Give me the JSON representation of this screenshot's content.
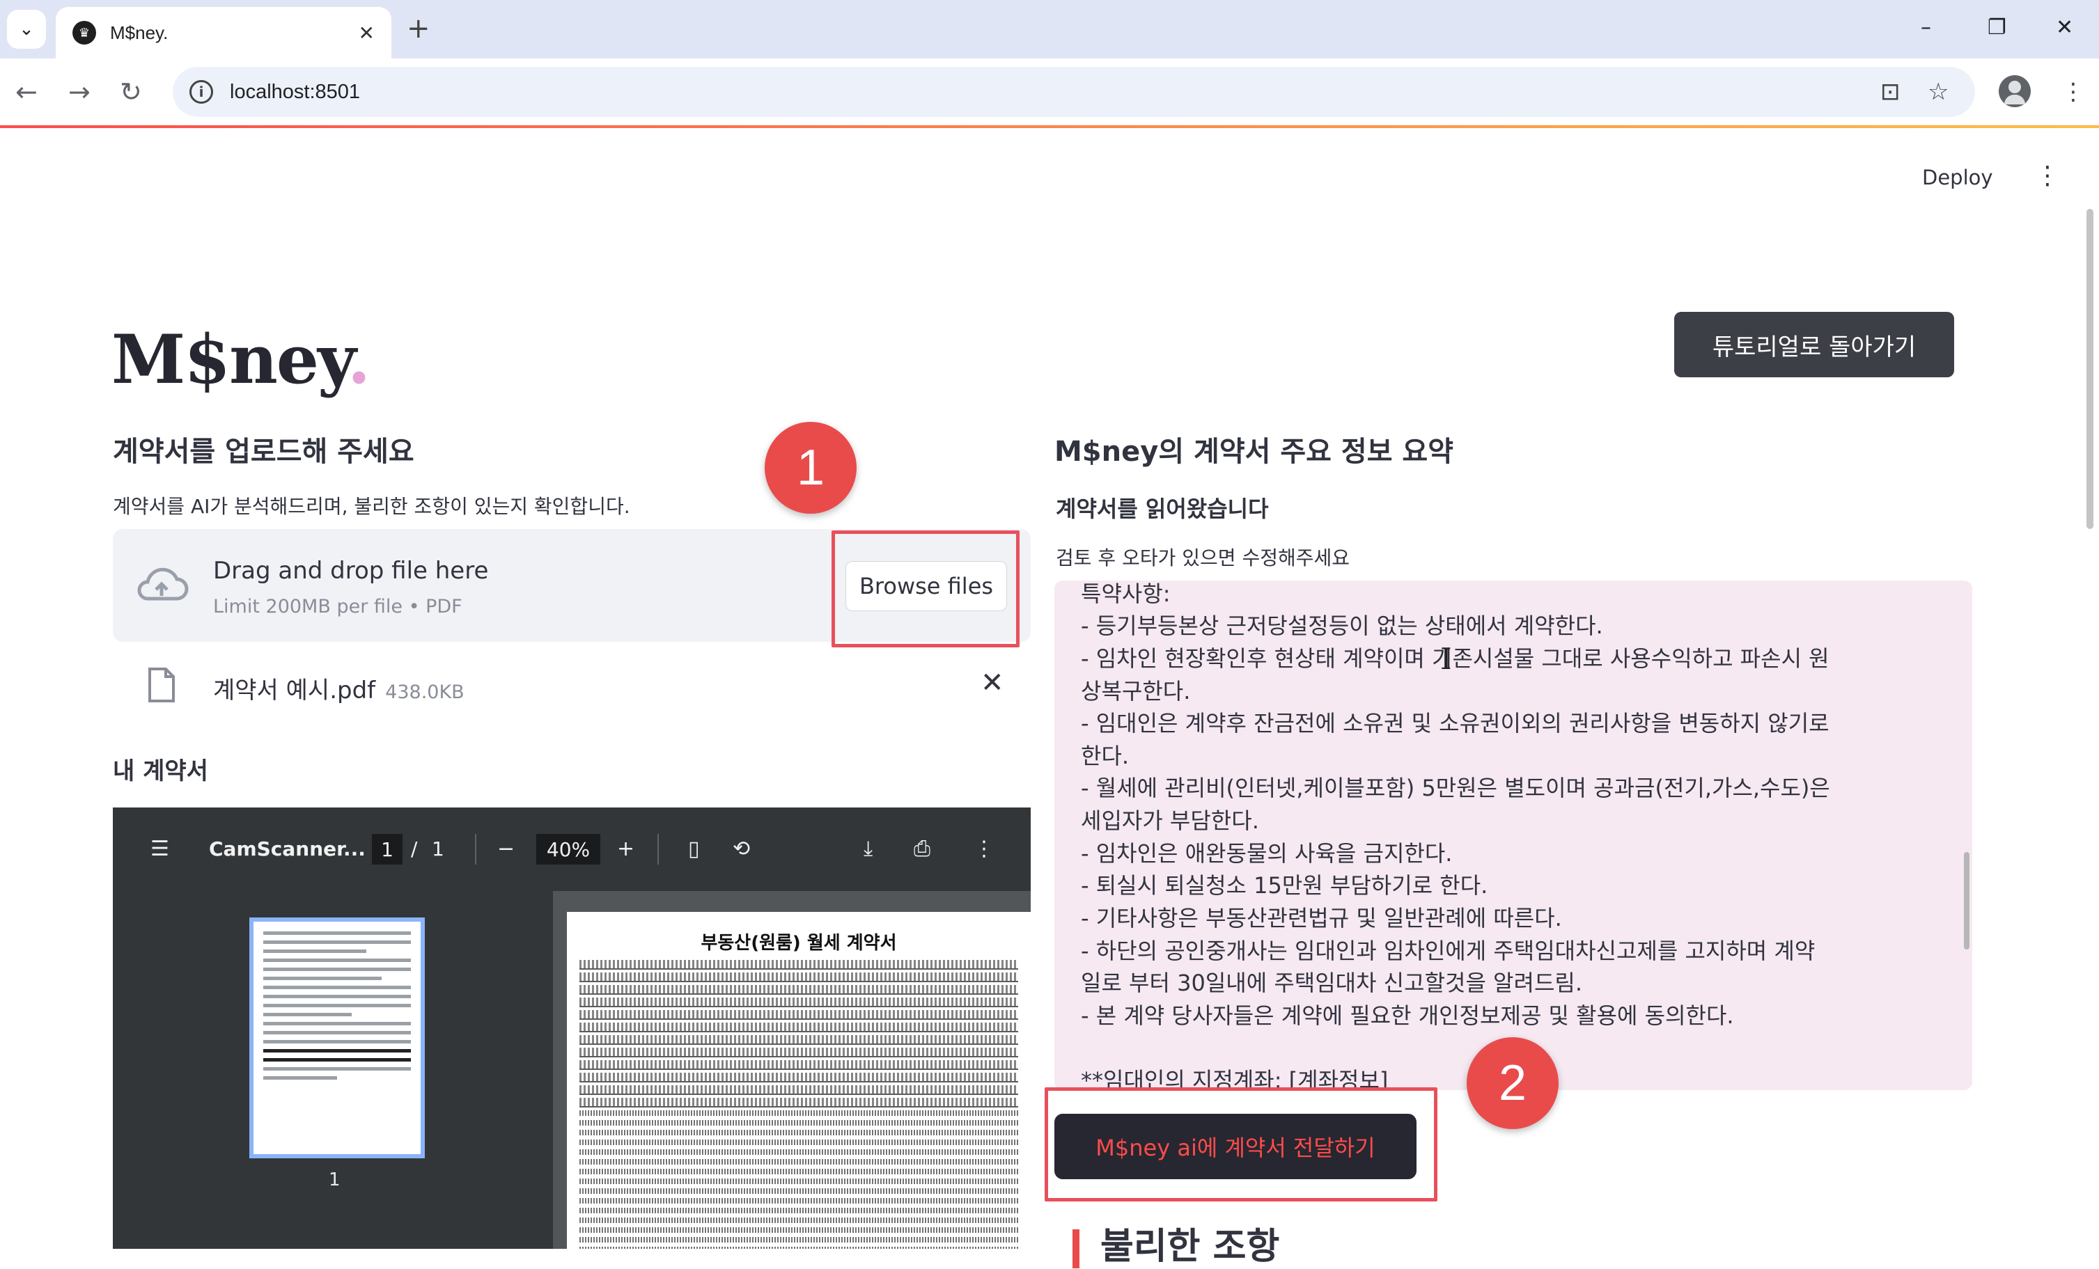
{
  "browser": {
    "tab_title": "M$ney.",
    "tab_favicon": "♛",
    "new_tab": "+",
    "url": "localhost:8501",
    "window_controls": [
      "–",
      "❐",
      "✕"
    ]
  },
  "app": {
    "deploy": "Deploy",
    "menu": "⋮",
    "logo_text": "M$ney",
    "logo_dot": ".",
    "tutorial_button": "튜토리얼로 돌아가기"
  },
  "upload": {
    "heading": "계약서를 업로드해 주세요",
    "caption": "계약서를 AI가 분석해드리며, 불리한 조항이 있는지 확인합니다.",
    "drag_text": "Drag and drop file here",
    "limit_text": "Limit 200MB per file • PDF",
    "browse_label": "Browse files",
    "file_name": "계약서 예시.pdf",
    "file_size": "438.0KB",
    "remove": "✕"
  },
  "annotations": {
    "badge1": "1",
    "badge2": "2"
  },
  "pdf": {
    "section_heading": "내 계약서",
    "doc_title": "CamScanner...",
    "page_current": "1",
    "page_sep": "/",
    "page_total": "1",
    "zoom_minus": "−",
    "zoom": "40%",
    "zoom_plus": "+",
    "thumb_page": "1",
    "page_title": "부동산(원룸) 월세 계약서"
  },
  "summary": {
    "heading": "M$ney의 계약서 주요 정보 요약",
    "subheading": "계약서를 읽어왔습니다",
    "caption": "검토 후 오타가 있으면 수정해주세요",
    "lines": [
      "특약사항:",
      "- 등기부등본상 근저당설정등이 없는 상태에서 계약한다.",
      "- 임차인 현장확인후 현상태 계약이며 기존시설물 그대로 사용수익하고 파손시 원",
      "상복구한다.",
      "- 임대인은 계약후 잔금전에 소유권 및 소유권이외의 권리사항을 변동하지 않기로",
      "한다.",
      "- 월세에 관리비(인터넷,케이블포함) 5만원은 별도이며 공과금(전기,가스,수도)은",
      "세입자가 부담한다.",
      "- 임차인은 애완동물의 사육을 금지한다.",
      "- 퇴실시 퇴실청소 15만원 부담하기로 한다.",
      "- 기타사항은 부동산관련법규 및 일반관례에 따른다.",
      "- 하단의 공인중개사는 임대인과 임차인에게 주택임대차신고제를 고지하며 계약",
      "일로 부터 30일내에 주택임대차 신고할것을 알려드림.",
      "- 본 계약 당사자들은 계약에 필요한 개인정보제공 및 활용에 동의한다.",
      "",
      "**임대인의 지정계좌: [계좌정보]"
    ],
    "submit_label": "M$ney ai에 계약서 전달하기",
    "next_heading": "불리한 조항"
  },
  "colors": {
    "accent_red": "#ff4b4b",
    "annotation_red": "#e8505b",
    "textarea_bg": "#f6e9f2"
  }
}
